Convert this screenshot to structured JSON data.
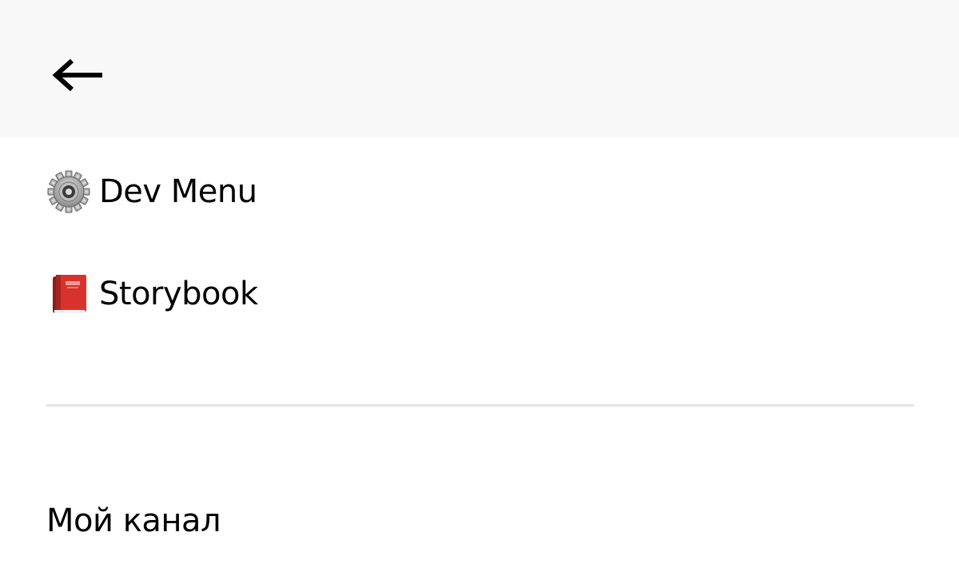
{
  "header": {
    "back_icon": "arrow-left-icon"
  },
  "menu": {
    "items": [
      {
        "label": "Dev Menu",
        "icon": "gear-icon"
      },
      {
        "label": "Storybook",
        "icon": "book-icon"
      }
    ]
  },
  "section": {
    "my_channel_label": "Мой канал"
  },
  "colors": {
    "header_bg": "#f8f8f8",
    "divider": "#e5e5e5",
    "book_red": "#d8322c"
  }
}
